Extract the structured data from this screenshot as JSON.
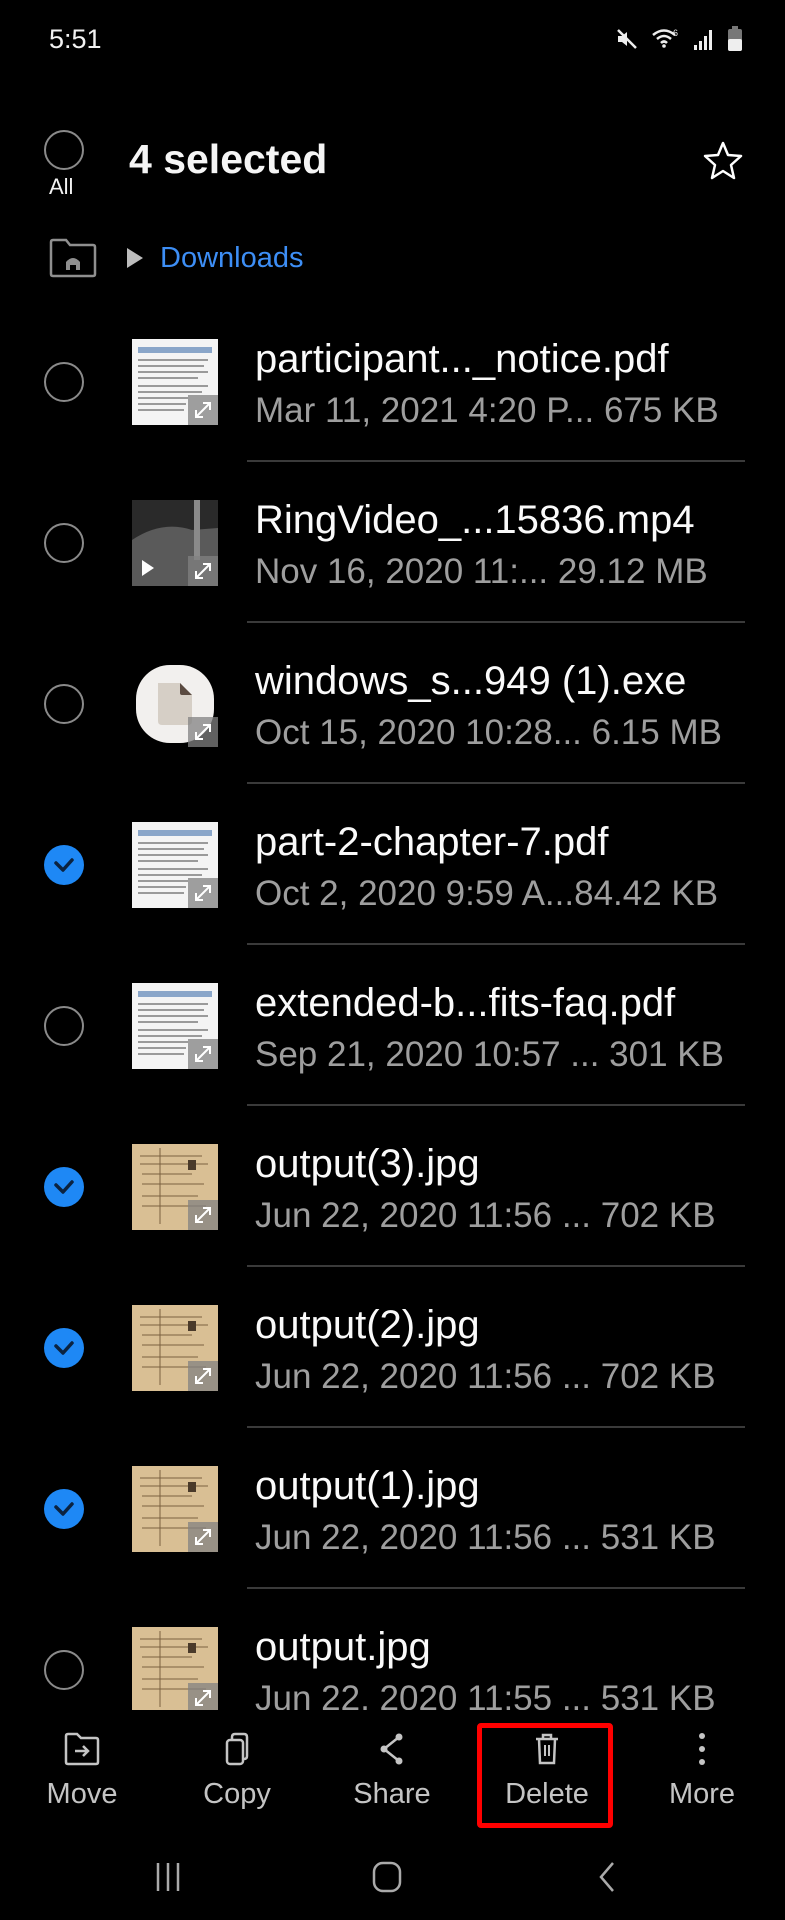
{
  "status_bar": {
    "time": "5:51",
    "icons": [
      "mute-icon",
      "wifi-icon",
      "signal-icon",
      "battery-icon"
    ]
  },
  "header": {
    "select_all_label": "All",
    "title": "4 selected",
    "favorite_icon": "star-icon"
  },
  "breadcrumb": {
    "home_icon": "home-folder-icon",
    "separator_icon": "triangle-right-icon",
    "current": "Downloads",
    "accent_color": "#3d8ef5"
  },
  "files": [
    {
      "name": "participant..._notice.pdf",
      "meta": "Mar 11, 2021 4:20 P... 675 KB",
      "selected": false,
      "type": "pdf"
    },
    {
      "name": "RingVideo_...15836.mp4",
      "meta": "Nov 16, 2020 11:...  29.12 MB",
      "selected": false,
      "type": "video"
    },
    {
      "name": "windows_s...949 (1).exe",
      "meta": "Oct 15, 2020 10:28... 6.15 MB",
      "selected": false,
      "type": "exe"
    },
    {
      "name": "part-2-chapter-7.pdf",
      "meta": "Oct 2, 2020 9:59 A...84.42 KB",
      "selected": true,
      "type": "pdf"
    },
    {
      "name": "extended-b...fits-faq.pdf",
      "meta": "Sep 21, 2020 10:57 ... 301 KB",
      "selected": false,
      "type": "pdf"
    },
    {
      "name": "output(3).jpg",
      "meta": "Jun 22, 2020 11:56 ... 702 KB",
      "selected": true,
      "type": "jpg"
    },
    {
      "name": "output(2).jpg",
      "meta": "Jun 22, 2020 11:56 ... 702 KB",
      "selected": true,
      "type": "jpg"
    },
    {
      "name": "output(1).jpg",
      "meta": "Jun 22, 2020 11:56 ... 531 KB",
      "selected": true,
      "type": "jpg"
    },
    {
      "name": "output.jpg",
      "meta": "Jun 22, 2020 11:55 ... 531 KB",
      "selected": false,
      "type": "jpg"
    }
  ],
  "toolbar": {
    "move": "Move",
    "copy": "Copy",
    "share": "Share",
    "delete": "Delete",
    "more": "More",
    "highlight_color": "#ff0000"
  },
  "navbar": {
    "recents_icon": "recent-apps-icon",
    "home_icon": "home-icon",
    "back_icon": "back-icon"
  },
  "colors": {
    "selected_check": "#1e88f5"
  }
}
